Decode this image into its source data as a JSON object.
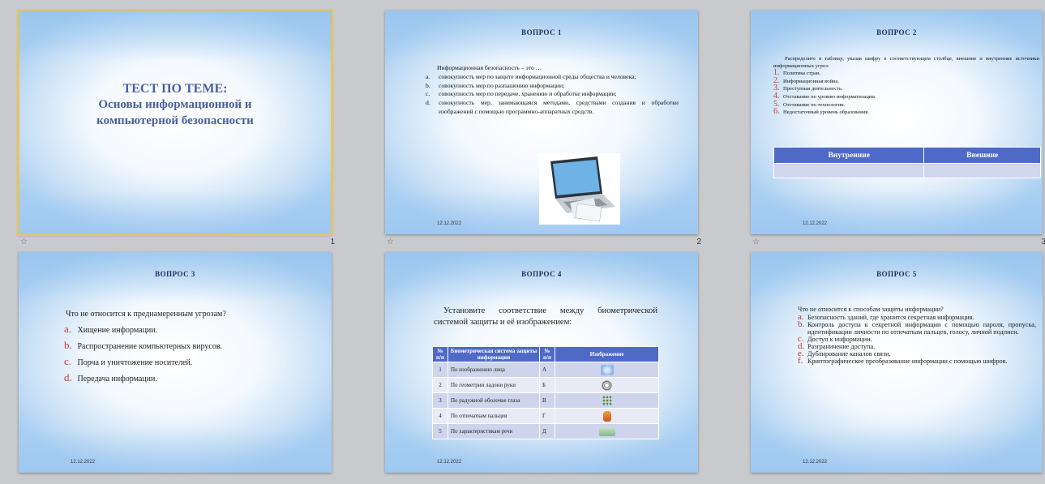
{
  "slides": [
    {
      "number": "1",
      "title_line1": "ТЕСТ ПО ТЕМЕ:",
      "title_line2": "Основы информационной и",
      "title_line3": "компьютерной безопасности",
      "selected": true
    },
    {
      "number": "2",
      "title": "ВОПРОС 1",
      "lead": "Информационная безопасность – это …",
      "items": [
        {
          "marker": "a.",
          "text": "совокупность мер по защите информационной среды общества и человека;"
        },
        {
          "marker": "b.",
          "text": "совокупность мер по разпашению информации;"
        },
        {
          "marker": "c.",
          "text": "совокупность мер по передаче, хранению и обработке информации;"
        },
        {
          "marker": "d.",
          "text": "совокупность мер, занимающаяся методами, средствами создания и обработки изображений с помощью программно-аппаратных средств."
        }
      ],
      "date": "12.12.2022"
    },
    {
      "number": "3",
      "title": "ВОПРОС 2",
      "lead": "Распределите в таблицу, указав шифру в соответствующем столбце, внешние и внутренние источники информационных угроз:",
      "items": [
        {
          "marker": "1.",
          "text": "Политика стран."
        },
        {
          "marker": "2.",
          "text": "Информационная война."
        },
        {
          "marker": "3.",
          "text": "Преступная деятельность."
        },
        {
          "marker": "4.",
          "text": "Отставание по уровню информатизации."
        },
        {
          "marker": "5.",
          "text": "Отставание по технологии."
        },
        {
          "marker": "6.",
          "text": "Недостаточный уровень образования."
        }
      ],
      "table_headers": [
        "Внутренние",
        "Внешние"
      ],
      "date": "12.12.2022"
    },
    {
      "number": "4",
      "title": "ВОПРОС 3",
      "lead": "Что не относится к преднамеренным угрозам?",
      "items": [
        {
          "marker": "a.",
          "text": "Хищение информации."
        },
        {
          "marker": "b.",
          "text": "Распространение компьютерных вирусов."
        },
        {
          "marker": "c.",
          "text": "Порча и уничтожение носителей."
        },
        {
          "marker": "d.",
          "text": "Передача информации."
        }
      ],
      "date": "12.12.2022"
    },
    {
      "number": "5",
      "title": "ВОПРОС 4",
      "lead": "Установите соответствие между биометрической системой защиты и её изображением:",
      "table_headers": [
        "№ п/п",
        "Биометрическая система защиты информации",
        "№ п/п",
        "Изображение"
      ],
      "rows": [
        {
          "n": "1",
          "text": "По изображению лица",
          "letter": "А",
          "icon": "face-scan-icon",
          "color": "#8fb4e8"
        },
        {
          "n": "2",
          "text": "По геометрии ладони руки",
          "letter": "Б",
          "icon": "spiral-icon",
          "color": "#888888"
        },
        {
          "n": "3",
          "text": "По радужной оболочке глаза",
          "letter": "В",
          "icon": "dots-grid-icon",
          "color": "#5a8a3a"
        },
        {
          "n": "4",
          "text": "По отпечаткам пальцев",
          "letter": "Г",
          "icon": "hand-icon",
          "color": "#e06a1a"
        },
        {
          "n": "5",
          "text": "По характеристикам речи",
          "letter": "Д",
          "icon": "keyboard-icon",
          "color": "#a0c8a8"
        }
      ],
      "date": "12.12.2022"
    },
    {
      "number": "6",
      "title": "ВОПРОС 5",
      "lead": "Что не относится к способам защиты информации?",
      "items": [
        {
          "marker": "a.",
          "text": "Безопасность зданий, где хранится секретная информация."
        },
        {
          "marker": "b.",
          "text": "Контроль доступа к секретной информации с помощью пароля, пропуска, идентификации личности по отпечаткам пальцев, голосу, личной подписи."
        },
        {
          "marker": "c.",
          "text": "Доступ к информации."
        },
        {
          "marker": "d.",
          "text": "Разграничение доступа."
        },
        {
          "marker": "e.",
          "text": "Дублирование каналов связи."
        },
        {
          "marker": "f.",
          "text": "Криптографическое преобразование информации с помощью шифров."
        }
      ],
      "date": "12.12.2022"
    }
  ],
  "star_glyph": "☆"
}
